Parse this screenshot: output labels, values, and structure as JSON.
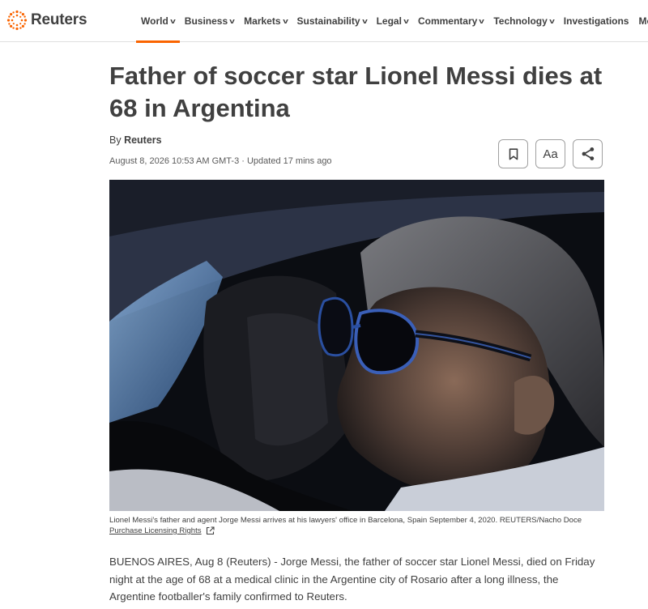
{
  "brand": {
    "name": "Reuters",
    "accent_color": "#fa6400"
  },
  "nav": {
    "items": [
      {
        "label": "World",
        "has_dropdown": true,
        "active": true
      },
      {
        "label": "Business",
        "has_dropdown": true
      },
      {
        "label": "Markets",
        "has_dropdown": true
      },
      {
        "label": "Sustainability",
        "has_dropdown": true
      },
      {
        "label": "Legal",
        "has_dropdown": true
      },
      {
        "label": "Commentary",
        "has_dropdown": true
      },
      {
        "label": "Technology",
        "has_dropdown": true
      },
      {
        "label": "Investigations",
        "has_dropdown": false
      },
      {
        "label": "Mo",
        "has_dropdown": false
      }
    ],
    "chevron_glyph": "v"
  },
  "article": {
    "headline": "Father of soccer star Lionel Messi dies at 68 in Argentina",
    "byline_prefix": "By ",
    "author": "Reuters",
    "dateline": "August 8, 2026 10:53 AM GMT-3 · Updated 17 mins ago",
    "tools": {
      "bookmark_icon": "bookmark-icon",
      "text_size_label": "Aa",
      "share_icon": "share-icon"
    },
    "photo": {
      "caption": "Lionel Messi's father and agent Jorge Messi arrives at his lawyers' office in Barcelona, Spain September 4, 2020. REUTERS/Nacho Doce",
      "license_link": "Purchase Licensing Rights",
      "license_icon": "external-link-icon"
    },
    "body": "BUENOS AIRES, Aug 8 (Reuters) - Jorge Messi, the father of soccer star Lionel Messi, died on Friday night at the age of 68 at a medical clinic in the Argentine city of Rosario after a long illness, the Argentine footballer's family confirmed to Reuters."
  }
}
